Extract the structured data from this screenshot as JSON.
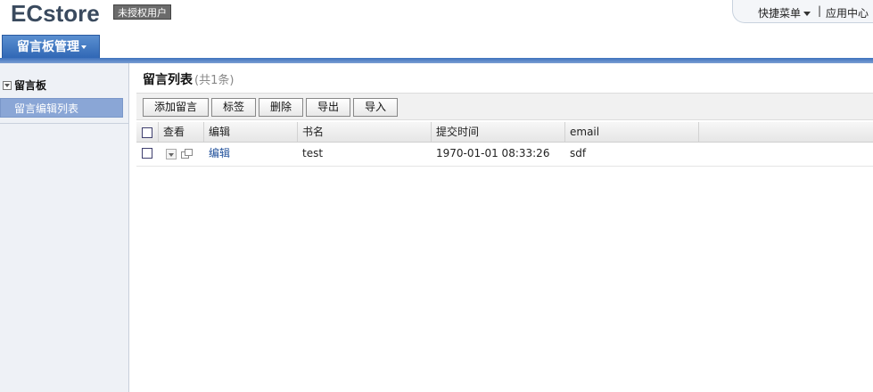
{
  "header": {
    "logo": "ECstore",
    "license_badge": "未授权用户",
    "quick_menu": "快捷菜单",
    "separator": "|",
    "app_center": "应用中心"
  },
  "nav": {
    "active_tab": "留言板管理"
  },
  "sidebar": {
    "group_label": "留言板",
    "items": [
      {
        "label": "留言编辑列表",
        "active": true
      }
    ]
  },
  "main": {
    "title": "留言列表",
    "count_text": "(共1条)",
    "toolbar": {
      "add": "添加留言",
      "tag": "标签",
      "delete": "删除",
      "export": "导出",
      "import": "导入"
    },
    "table": {
      "columns": [
        "查看",
        "编辑",
        "书名",
        "提交时间",
        "email"
      ],
      "rows": [
        {
          "edit": "编辑",
          "name": "test",
          "time": "1970-01-01 08:33:26",
          "email": "sdf"
        }
      ]
    }
  },
  "colors": {
    "accent": "#2f66b4",
    "sidebar_active": "#8aa6d6",
    "link": "#1f4f9a"
  }
}
